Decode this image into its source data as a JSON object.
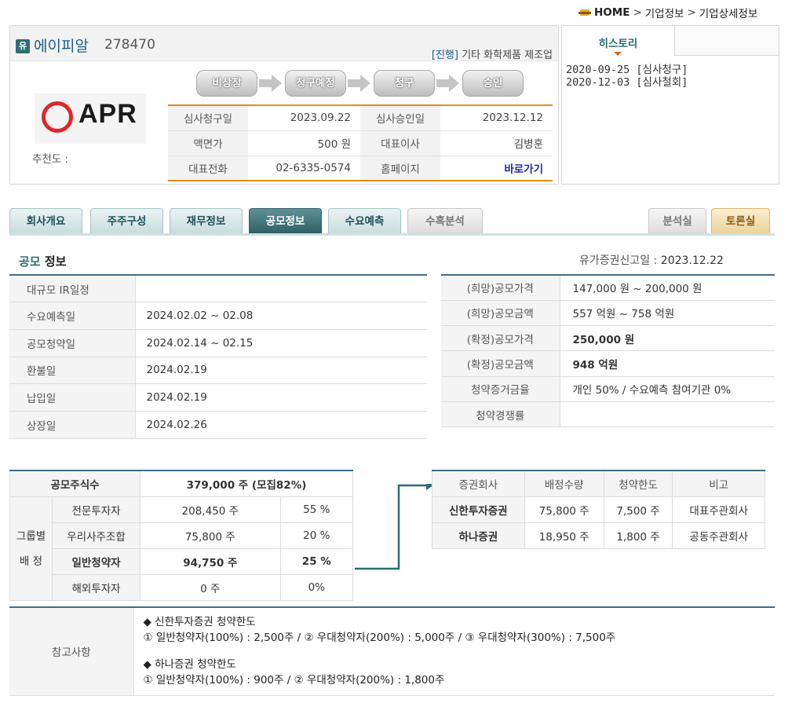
{
  "breadcrumb": {
    "home": "HOME",
    "sep": ">",
    "level1": "기업정보",
    "level2": "기업상세정보"
  },
  "company": {
    "badge": "유",
    "name": "에이피알",
    "code": "278470",
    "status": "[진행]",
    "industry": "기타 화학제품 제조업",
    "logo_text": "APR",
    "recommend_label": "추천도 :"
  },
  "steps": [
    "비상장",
    "청구예정",
    "청구",
    "승인"
  ],
  "summary": {
    "rows": [
      {
        "l1": "심사청구일",
        "v1": "2023.09.22",
        "l2": "심사승인일",
        "v2": "2023.12.12"
      },
      {
        "l1": "액면가",
        "v1": "500 원",
        "l2": "대표이사",
        "v2": "김병훈"
      },
      {
        "l1": "대표전화",
        "v1": "02-6335-0574",
        "l2": "홈페이지",
        "v2": "바로가기"
      }
    ]
  },
  "history": {
    "tab": "히스토리",
    "items": [
      "2020-09-25 [심사청구]",
      "2020-12-03 [심사철회]"
    ]
  },
  "tabs": [
    {
      "label": "회사개요",
      "state": "normal"
    },
    {
      "label": "주주구성",
      "state": "normal"
    },
    {
      "label": "재무정보",
      "state": "normal"
    },
    {
      "label": "공모정보",
      "state": "active"
    },
    {
      "label": "수요예측",
      "state": "normal"
    },
    {
      "label": "수혹분석",
      "state": "gray"
    },
    {
      "label": "분석실",
      "state": "gray"
    },
    {
      "label": "토론실",
      "state": "orange"
    }
  ],
  "section": {
    "title_hl": "공모",
    "title_rest": " 정보",
    "report_label": "유가증권신고일 : ",
    "report_date": "2023.12.22"
  },
  "schedule": [
    {
      "label": "대규모 IR일정",
      "value": ""
    },
    {
      "label": "수요예측일",
      "value": "2024.02.02 ~ 02.08"
    },
    {
      "label": "공모청약일",
      "value": "2024.02.14 ~ 02.15"
    },
    {
      "label": "환불일",
      "value": "2024.02.19"
    },
    {
      "label": "납입일",
      "value": "2024.02.19"
    },
    {
      "label": "상장일",
      "value": "2024.02.26"
    }
  ],
  "pricing": [
    {
      "label": "(희망)공모가격",
      "value": "147,000 원 ~ 200,000 원",
      "emph": false
    },
    {
      "label": "(희망)공모금액",
      "value": "557 억원  ~ 758 억원",
      "emph": false
    },
    {
      "label": "(확정)공모가격",
      "value": "250,000 원",
      "emph": true
    },
    {
      "label": "(확정)공모금액",
      "value": "948 억원",
      "emph": true
    },
    {
      "label": "청약증거금율",
      "value": "개인 50% / 수요예측 참여기관 0%",
      "emph": false
    },
    {
      "label": "청약경쟁률",
      "value": "",
      "emph": false
    }
  ],
  "shares": {
    "total_label": "공모주식수",
    "total_value": "379,000 주 (모집82%)",
    "group_label_1": "그룹별",
    "group_label_2": "배 정",
    "rows": [
      {
        "label": "전문투자자",
        "shares": "208,450 주",
        "pct": "55 %",
        "bold": false
      },
      {
        "label": "우리사주조합",
        "shares": "75,800 주",
        "pct": "20 %",
        "bold": false
      },
      {
        "label": "일반청약자",
        "shares": "94,750 주",
        "pct": "25 %",
        "bold": true
      },
      {
        "label": "해외투자자",
        "shares": "0 주",
        "pct": "0%",
        "bold": false
      }
    ]
  },
  "brokers": {
    "headers": [
      "증권회사",
      "배정수량",
      "청약한도",
      "비고"
    ],
    "rows": [
      {
        "name": "신한투자증권",
        "qty": "75,800 주",
        "limit": "7,500 주",
        "note": "대표주관회사"
      },
      {
        "name": "하나증권",
        "qty": "18,950 주",
        "limit": "1,800 주",
        "note": "공동주관회사"
      }
    ]
  },
  "notes": {
    "label": "참고사항",
    "lines": [
      "◆ 신한투자증권 청약한도",
      "① 일반청약자(100%) : 2,500주 / ② 우대청약자(200%) : 5,000주 / ③ 우대청약자(300%) : 7,500주",
      "◆ 하나증권 청약한도",
      "① 일반청약자(100%) : 900주 / ② 우대청약자(200%) : 1,800주"
    ]
  },
  "colors": {
    "accent_teal": "#2b6d70",
    "emphasis_red": "#a02a1c",
    "link_blue": "#2a2aa8",
    "table_border": "#3e6d86"
  }
}
